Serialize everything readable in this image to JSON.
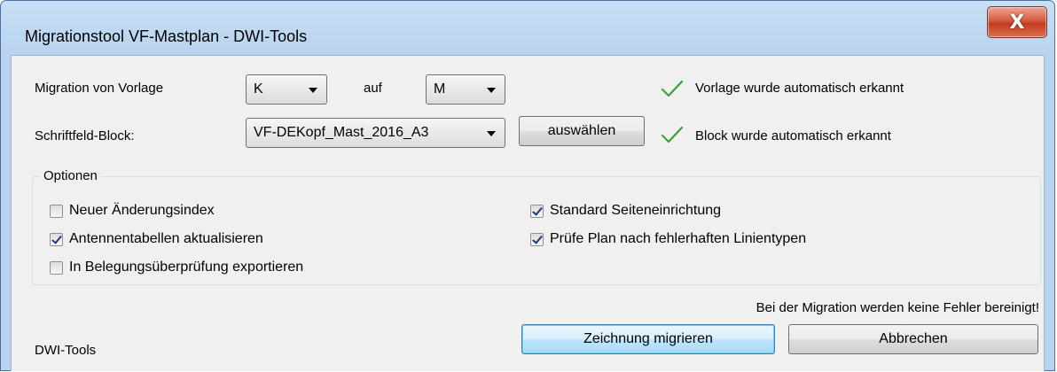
{
  "window": {
    "title": "Migrationstool VF-Mastplan - DWI-Tools",
    "close_glyph": "X"
  },
  "migration": {
    "label": "Migration von Vorlage",
    "from_value": "K",
    "to_label": "auf",
    "to_value": "M",
    "status_text": "Vorlage wurde automatisch erkannt"
  },
  "block": {
    "label": "Schriftfeld-Block:",
    "value": "VF-DEKopf_Mast_2016_A3",
    "select_button_label": "auswählen",
    "status_text": "Block wurde automatisch erkannt"
  },
  "options": {
    "title": "Optionen",
    "items": [
      {
        "label": "Neuer Änderungsindex",
        "checked": false
      },
      {
        "label": "Antennentabellen aktualisieren",
        "checked": true
      },
      {
        "label": "In Belegungsüberprüfung exportieren",
        "checked": false
      },
      {
        "label": "Standard Seiteneinrichtung",
        "checked": true
      },
      {
        "label": "Prüfe Plan nach fehlerhaften Linientypen",
        "checked": true
      }
    ]
  },
  "footer": {
    "notice": "Bei der Migration werden keine Fehler bereinigt!",
    "brand": "DWI-Tools",
    "migrate_button_label": "Zeichnung migrieren",
    "cancel_button_label": "Abbrechen"
  },
  "colors": {
    "check_green": "#3aa23a",
    "client_background": "#f0f0f0",
    "title_bar": "#b9d3ef",
    "close_red": "#c23b22"
  }
}
